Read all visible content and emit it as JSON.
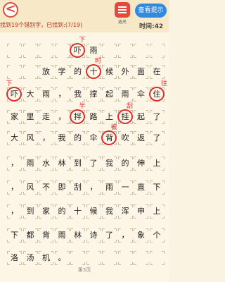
{
  "header": {
    "back_glyph": "<",
    "progress_text": "找到19个错别字，已找到:(7/19)",
    "level_label": "选关",
    "hint_label": "查看提示",
    "timer_text": "时间:42"
  },
  "passage": {
    "rows": [
      [
        "",
        "",
        "",
        "",
        "",
        "",
        "",
        "",
        ""
      ],
      [
        "",
        "",
        "",
        "",
        "",
        "",
        "",
        "",
        ""
      ],
      [
        "",
        "",
        "",
        "",
        "",
        "",
        "",
        "",
        ""
      ],
      [
        "",
        "",
        "",
        "",
        "",
        "",
        "",
        "",
        ""
      ],
      [
        "",
        "",
        "",
        "",
        "",
        "",
        "",
        "",
        ""
      ],
      [
        "",
        "",
        "",
        "",
        "",
        "",
        "",
        "",
        ""
      ],
      [
        "",
        "",
        "",
        "",
        "",
        "",
        "",
        "",
        ""
      ],
      [
        "",
        "",
        "",
        "",
        "",
        "",
        "",
        "",
        ""
      ],
      [
        "",
        "",
        "",
        "",
        "",
        "",
        "",
        "",
        ""
      ],
      [
        "",
        "",
        "",
        "",
        "",
        "",
        "",
        "",
        ""
      ],
      [
        "",
        "",
        "",
        "",
        "",
        "",
        "",
        "",
        ""
      ],
      [
        "",
        "",
        "",
        "",
        "",
        "",
        "",
        "",
        ""
      ]
    ],
    "text_rows": [
      [
        "",
        "",
        "",
        "",
        "吓",
        "雨",
        "",
        "",
        ""
      ],
      [
        "",
        "",
        "放",
        "学",
        "的",
        "十",
        "候",
        "外",
        "面",
        "在"
      ],
      [
        "吓",
        "大",
        "雨",
        "，",
        "我",
        "撑",
        "起",
        "雨",
        "伞",
        "住"
      ],
      [
        "家",
        "里",
        "走",
        "，",
        "拌",
        "路",
        "上",
        "挂",
        "起",
        "了"
      ],
      [
        "大",
        "风",
        "，",
        "我",
        "的",
        "伞",
        "背",
        "吹",
        "返",
        "了"
      ],
      [
        "，",
        "雨",
        "水",
        "林",
        "到",
        "了",
        "我",
        "的",
        "伸",
        "上"
      ],
      [
        "，",
        "风",
        "不",
        "即",
        "刮",
        "，",
        "雨",
        "一",
        "直",
        "下"
      ],
      [
        "，",
        "到",
        "家",
        "的",
        "十",
        "候",
        "我",
        "浑",
        "申",
        "上"
      ],
      [
        "下",
        "都",
        "背",
        "雨",
        "林",
        "诗",
        "了",
        "，",
        "象",
        "个"
      ],
      [
        "洛",
        "汤",
        "机",
        "。",
        "",
        "",
        "",
        "",
        "",
        ""
      ]
    ],
    "found": [
      {
        "row": 0,
        "col": 4,
        "correction": "下"
      },
      {
        "row": 1,
        "col": 5,
        "correction": "时"
      },
      {
        "row": 2,
        "col": 0,
        "correction": "下"
      },
      {
        "row": 2,
        "col": 9,
        "correction": "往"
      },
      {
        "row": 3,
        "col": 4,
        "correction": "半"
      },
      {
        "row": 3,
        "col": 7,
        "correction": "刮"
      },
      {
        "row": 4,
        "col": 6,
        "correction": "被"
      }
    ]
  },
  "footer": {
    "page_label": "第3页"
  }
}
